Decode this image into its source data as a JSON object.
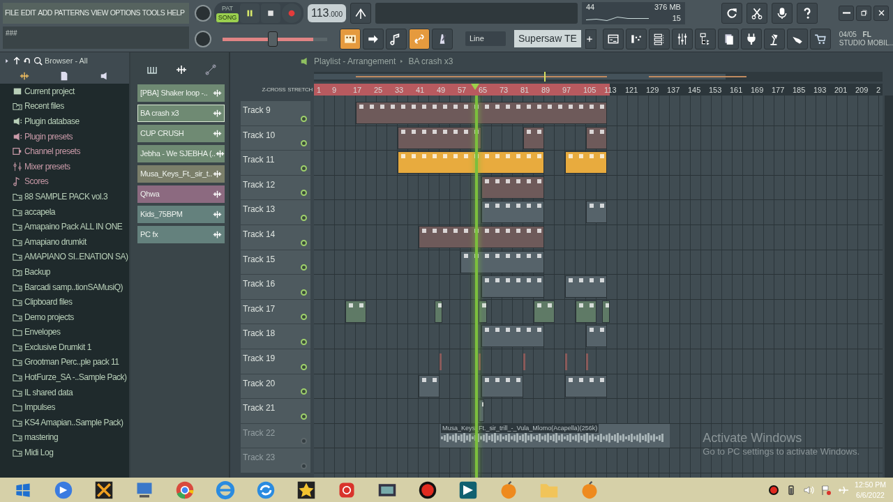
{
  "menu": [
    "FILE",
    "EDIT",
    "ADD",
    "PATTERNS",
    "VIEW",
    "OPTIONS",
    "TOOLS",
    "HELP"
  ],
  "hint": "###",
  "transport": {
    "pat_label": "PAT",
    "song_label": "SONG",
    "song_mode": true,
    "playing": true,
    "recording": true,
    "tempo": "113",
    "tempo_fraction": ".000"
  },
  "master_pitch": {
    "level": 0.48
  },
  "tools": [
    {
      "kind": "typing",
      "on": true
    },
    {
      "kind": "arrow",
      "on": false
    },
    {
      "kind": "note",
      "on": false
    },
    {
      "kind": "link",
      "on": true
    },
    {
      "kind": "metronome",
      "on": false
    }
  ],
  "snap": "Line",
  "pattern": "Supersaw TE",
  "cpu": {
    "voices": "44",
    "memory": "376 MB",
    "polyphony": "15"
  },
  "top_buttons": [
    {
      "kind": "undo"
    },
    {
      "kind": "scissors"
    },
    {
      "kind": "mic"
    },
    {
      "kind": "help"
    }
  ],
  "view_buttons": [
    {
      "kind": "playlist"
    },
    {
      "kind": "steps"
    },
    {
      "kind": "rack"
    },
    {
      "kind": "mixer"
    },
    {
      "kind": "tree"
    },
    {
      "kind": "pages"
    },
    {
      "kind": "plug"
    },
    {
      "kind": "lamp"
    },
    {
      "kind": "hand"
    },
    {
      "kind": "cart"
    }
  ],
  "news": {
    "date": "04/05",
    "brand": "FL",
    "text": "STUDIO MOBIL.."
  },
  "browser": {
    "title": "Browser - All",
    "items": [
      {
        "label": "Current project",
        "kind": "project",
        "color": "#b9d0b9"
      },
      {
        "label": "Recent files",
        "kind": "recent",
        "color": "#b9d0b9"
      },
      {
        "label": "Plugin database",
        "kind": "plugin",
        "color": "#b9d0b9"
      },
      {
        "label": "Plugin presets",
        "kind": "plugin",
        "color": "#c99aa8"
      },
      {
        "label": "Channel presets",
        "kind": "channel",
        "color": "#c99aa8"
      },
      {
        "label": "Mixer presets",
        "kind": "mixer",
        "color": "#c99aa8"
      },
      {
        "label": "Scores",
        "kind": "score",
        "color": "#c99aa8"
      },
      {
        "label": "88 SAMPLE PACK vol.3",
        "kind": "folder",
        "color": "#b9d0b9"
      },
      {
        "label": "accapela",
        "kind": "folder",
        "color": "#b9d0b9"
      },
      {
        "label": "Amapaino Pack ALL IN ONE",
        "kind": "folder",
        "color": "#b9d0b9"
      },
      {
        "label": "Amapiano drumkit",
        "kind": "folder",
        "color": "#b9d0b9"
      },
      {
        "label": "AMAPIANO SI..ENATION SA)",
        "kind": "folder",
        "color": "#b9d0b9"
      },
      {
        "label": "Backup",
        "kind": "recent",
        "color": "#b9d0b9"
      },
      {
        "label": "Barcadi samp..tionSAMusiQ)",
        "kind": "folder",
        "color": "#b9d0b9"
      },
      {
        "label": "Clipboard files",
        "kind": "folder",
        "color": "#b9d0b9"
      },
      {
        "label": "Demo projects",
        "kind": "folder",
        "color": "#b9d0b9"
      },
      {
        "label": "Envelopes",
        "kind": "plain",
        "color": "#b9d0b9"
      },
      {
        "label": "Exclusive Drumkit 1",
        "kind": "folder",
        "color": "#b9d0b9"
      },
      {
        "label": "Grootman Perc..ple pack 11",
        "kind": "folder",
        "color": "#b9d0b9"
      },
      {
        "label": "HotFurze_SA -..Sample Pack)",
        "kind": "folder",
        "color": "#b9d0b9"
      },
      {
        "label": "IL shared data",
        "kind": "folder",
        "color": "#b9d0b9"
      },
      {
        "label": "Impulses",
        "kind": "plain",
        "color": "#b9d0b9"
      },
      {
        "label": "KS4 Amapian..Sample Pack)",
        "kind": "folder",
        "color": "#b9d0b9"
      },
      {
        "label": "mastering",
        "kind": "folder",
        "color": "#b9d0b9"
      },
      {
        "label": "Midi Log",
        "kind": "folder",
        "color": "#b9d0b9"
      }
    ]
  },
  "picker": [
    {
      "label": "[PBA] Shaker loop -..",
      "color": "#6f8a73",
      "selected": false
    },
    {
      "label": "BA crash x3",
      "color": "#6f8a73",
      "selected": true
    },
    {
      "label": "CUP CRUSH",
      "color": "#6f8a73",
      "selected": false
    },
    {
      "label": "Jebha - We SJEBHA (..",
      "color": "#6f8a73",
      "selected": false
    },
    {
      "label": "Musa_Keys_Ft._sir_t..",
      "color": "#7b7f6a",
      "selected": false
    },
    {
      "label": "Qhwa",
      "color": "#8c6a80",
      "selected": false
    },
    {
      "label": "Kids_75BPM",
      "color": "#64817d",
      "selected": false
    },
    {
      "label": "PC fx",
      "color": "#64817d",
      "selected": false
    }
  ],
  "playlist": {
    "title": "Playlist - Arrangement",
    "pattern": "BA crash x3",
    "z_cross": "Z-CROSS",
    "stretch": "STRETCH",
    "ruler": [
      "1",
      "9",
      "17",
      "25",
      "33",
      "41",
      "49",
      "57",
      "65",
      "73",
      "81",
      "89",
      "97",
      "105",
      "113",
      "121",
      "129",
      "137",
      "145",
      "153",
      "161",
      "169",
      "177",
      "185",
      "193",
      "201",
      "209",
      "2"
    ],
    "selection": {
      "level": 0.52
    },
    "playhead": {
      "level": 0.283
    },
    "tracks": [
      {
        "name": "Track 9",
        "enabled": true,
        "color": "#6e5a5a"
      },
      {
        "name": "Track 10",
        "enabled": true,
        "color": "#6e5a5a"
      },
      {
        "name": "Track 11",
        "enabled": true,
        "color": "#e8ab3e"
      },
      {
        "name": "Track 12",
        "enabled": true,
        "color": "#6e5a5a"
      },
      {
        "name": "Track 13",
        "enabled": true,
        "color": "#56636a"
      },
      {
        "name": "Track 14",
        "enabled": true,
        "color": "#6e5a5a"
      },
      {
        "name": "Track 15",
        "enabled": true,
        "color": "#56636a"
      },
      {
        "name": "Track 16",
        "enabled": true,
        "color": "#56636a"
      },
      {
        "name": "Track 17",
        "enabled": true,
        "color": "#5f7a66"
      },
      {
        "name": "Track 18",
        "enabled": true,
        "color": "#56636a"
      },
      {
        "name": "Track 19",
        "enabled": true,
        "color": "#8a5a5a"
      },
      {
        "name": "Track 20",
        "enabled": true,
        "color": "#56636a"
      },
      {
        "name": "Track 21",
        "enabled": true,
        "color": "#56636a"
      },
      {
        "name": "Track 22",
        "enabled": false,
        "color": "#56636a",
        "audio_clip": "Musa_Keys_Ft._sir_trill_-_Vula_Mlomo(Acapella)(256k)"
      },
      {
        "name": "Track 23",
        "enabled": false
      }
    ]
  },
  "activation": {
    "title": "Activate Windows",
    "text": "Go to PC settings to activate Windows."
  },
  "taskbar": {
    "apps": [
      {
        "kind": "start"
      },
      {
        "kind": "chat"
      },
      {
        "kind": "crate"
      },
      {
        "kind": "explorer"
      },
      {
        "kind": "chrome"
      },
      {
        "kind": "ie"
      },
      {
        "kind": "sync"
      },
      {
        "kind": "star"
      },
      {
        "kind": "redapp"
      },
      {
        "kind": "film"
      },
      {
        "kind": "record"
      },
      {
        "kind": "arrowapp"
      },
      {
        "kind": "fruit"
      },
      {
        "kind": "folder"
      },
      {
        "kind": "fruit"
      }
    ],
    "tray": [
      {
        "kind": "record"
      },
      {
        "kind": "battery"
      },
      {
        "kind": "volume"
      },
      {
        "kind": "flag"
      },
      {
        "kind": "plane"
      }
    ],
    "time": "12:50 PM",
    "date": "6/6/2022"
  }
}
